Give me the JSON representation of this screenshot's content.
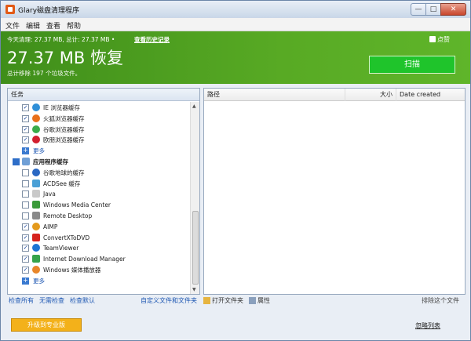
{
  "window": {
    "title": "Glary磁盘清理程序",
    "min": "—",
    "max": "□",
    "close": "✕"
  },
  "menu": [
    "文件",
    "编辑",
    "查看",
    "帮助"
  ],
  "banner": {
    "line1": "今天清理: 27.37 MB, 总计: 27.37 MB •",
    "history": "查看历史记录",
    "big": "27.37 MB 恢复",
    "sub": "总计移除 197 个垃圾文件。",
    "like": "点赞",
    "scan": "扫描"
  },
  "left_panel": {
    "header": "任务",
    "items": [
      {
        "label": "IE 浏览器缓存",
        "checked": "✓",
        "icon": "ie-icon",
        "color": "#2f8fd8"
      },
      {
        "label": "火狐浏览器缓存",
        "checked": "✓",
        "icon": "firefox-icon",
        "color": "#e8701b"
      },
      {
        "label": "谷歌浏览器缓存",
        "checked": "✓",
        "icon": "chrome-icon",
        "color": "#3bab4a"
      },
      {
        "label": "欧朋浏览器缓存",
        "checked": "✓",
        "icon": "opera-icon",
        "color": "#d21f2f"
      },
      {
        "label": "更多",
        "type": "more"
      },
      {
        "label": "应用程序缓存",
        "type": "group"
      },
      {
        "label": "谷歌地球的缓存",
        "checked": "",
        "icon": "google-earth-icon",
        "color": "#2a68c3"
      },
      {
        "label": "ACDSee 缓存",
        "checked": "",
        "icon": "acdsee-icon",
        "color": "#4aa0d6"
      },
      {
        "label": "Java",
        "checked": "",
        "icon": "java-icon",
        "color": "#c9c9c9"
      },
      {
        "label": "Windows Media Center",
        "checked": "",
        "icon": "media-center-icon",
        "color": "#3b9b39"
      },
      {
        "label": "Remote Desktop",
        "checked": "",
        "icon": "remote-desktop-icon",
        "color": "#8a8a8a"
      },
      {
        "label": "AIMP",
        "checked": "✓",
        "icon": "aimp-icon",
        "color": "#e49a1c"
      },
      {
        "label": "ConvertXToDVD",
        "checked": "✓",
        "icon": "convertxtodvd-icon",
        "color": "#d6231d"
      },
      {
        "label": "TeamViewer",
        "checked": "✓",
        "icon": "teamviewer-icon",
        "color": "#1c74d3"
      },
      {
        "label": "Internet Download Manager",
        "checked": "✓",
        "icon": "idm-icon",
        "color": "#36a34b"
      },
      {
        "label": "Windows 媒体播放器",
        "checked": "✓",
        "icon": "media-player-icon",
        "color": "#e8862a"
      },
      {
        "label": "更多",
        "type": "more"
      }
    ]
  },
  "right_panel": {
    "columns": [
      "路径",
      "大小",
      "Date created"
    ]
  },
  "bottom": {
    "check_all": "检查所有",
    "uncheck": "无需检查",
    "check_default": "检查默认",
    "custom": "自定义文件和文件夹",
    "open_folder": "打开文件夹",
    "properties": "属性",
    "ignore_file": "排除这个文件",
    "upgrade": "升级到专业版",
    "ignore_list": "忽略列表"
  }
}
